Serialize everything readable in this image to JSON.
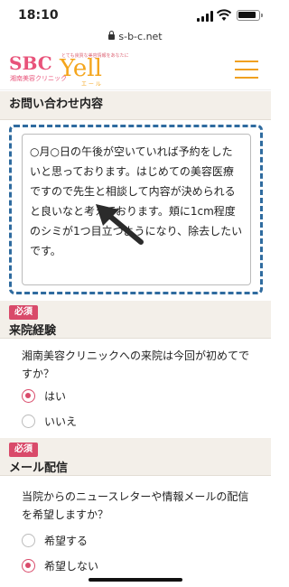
{
  "status_bar": {
    "time": "18:10"
  },
  "browser": {
    "url": "s-b-c.net"
  },
  "header": {
    "logo_main": "SBC",
    "logo_sub": "湘南美容クリニック",
    "logo_yell": "Yell",
    "logo_yell_tag": "とても良質な美容情報をあなたに",
    "logo_yell_sub": "エ ー ル",
    "menu_icon": "hamburger-menu-icon"
  },
  "inquiry": {
    "heading": "お問い合わせ内容",
    "text": "○月○日の午後が空いていれば予約をしたいと思っております。はじめての美容医療ですので先生と相談して内容が決められると良いなと考えております。頬に1cm程度のシミが1つ目立つようになり、除去したいです。"
  },
  "visit": {
    "required": "必須",
    "heading": "来院経験",
    "question": "湘南美容クリニックへの来院は今回が初めてですか？",
    "options": [
      {
        "label": "はい",
        "checked": true
      },
      {
        "label": "いいえ",
        "checked": false
      }
    ]
  },
  "mail": {
    "required": "必須",
    "heading": "メール配信",
    "question": "当院からのニュースレターや情報メールの配信を希望しますか？",
    "options": [
      {
        "label": "希望する",
        "checked": false
      },
      {
        "label": "希望しない",
        "checked": true
      }
    ]
  },
  "colors": {
    "accent": "#d94a6a",
    "highlight": "#2f6b9f",
    "brand_orange": "#f0a020"
  }
}
